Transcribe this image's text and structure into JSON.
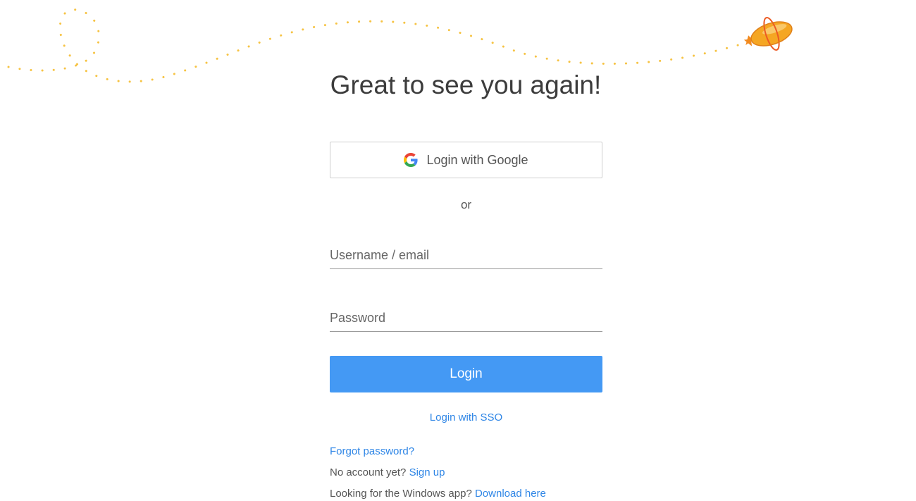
{
  "heading": "Great to see you again!",
  "google_login": {
    "label": "Login with Google",
    "icon": "google-icon"
  },
  "divider_text": "or",
  "username": {
    "placeholder": "Username / email",
    "value": ""
  },
  "password": {
    "placeholder": "Password",
    "value": ""
  },
  "login_button": "Login",
  "sso_link": "Login with SSO",
  "forgot_password": "Forgot password?",
  "signup": {
    "prompt": "No account yet?",
    "link": "Sign up"
  },
  "windows_app": {
    "prompt": "Looking for the Windows app?",
    "link": "Download here"
  },
  "decoration": {
    "icon": "airship-icon",
    "trail_color": "#f6c343",
    "airship_color": "#f5a623"
  },
  "colors": {
    "primary": "#4499f4",
    "link": "#2f86e6",
    "heading": "#3c3c3c"
  }
}
